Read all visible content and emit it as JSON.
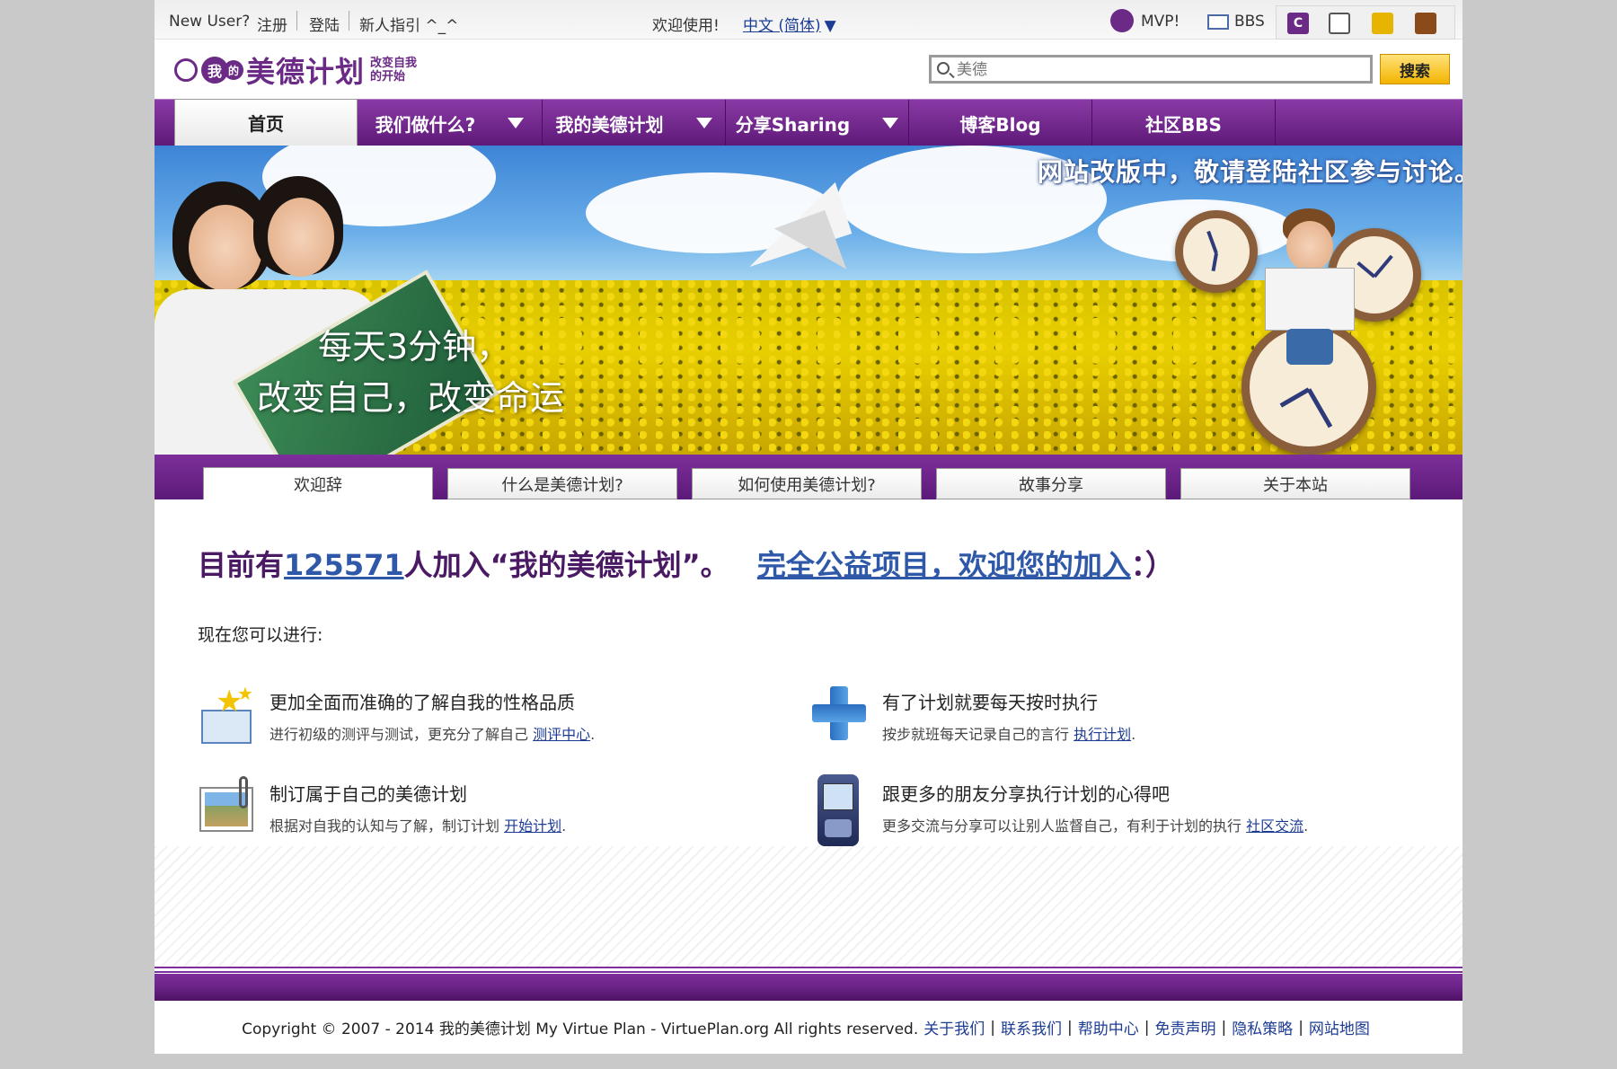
{
  "topbar": {
    "new_user": "New User?",
    "register": "注册",
    "login": "登陆",
    "guide": "新人指引 ^_^",
    "welcome": "欢迎使用!",
    "language": "中文 (简体)",
    "mvp": "MVP!",
    "bbs": "BBS",
    "icons": [
      "c-icon",
      "window-icon",
      "coins-icon",
      "shield-icon"
    ]
  },
  "header": {
    "logo_prefix": "我",
    "logo_bubble": "的",
    "logo_name": "美德计划",
    "logo_slogan": "改变自我的开始",
    "search_placeholder": "美德",
    "search_button": "搜索"
  },
  "nav": {
    "items": [
      {
        "label": "首页",
        "dropdown": false,
        "active": true
      },
      {
        "label": "我们做什么?",
        "dropdown": true,
        "active": false
      },
      {
        "label": "我的美德计划",
        "dropdown": true,
        "active": false
      },
      {
        "label": "分享Sharing",
        "dropdown": true,
        "active": false
      },
      {
        "label": "博客Blog",
        "dropdown": false,
        "active": false
      },
      {
        "label": "社区BBS",
        "dropdown": false,
        "active": false
      }
    ]
  },
  "banner": {
    "notice": "网站改版中，敬请登陆社区参与讨论。",
    "line1": "每天3分钟，",
    "line2": "改变自己，改变命运"
  },
  "subtabs": [
    "欢迎辞",
    "什么是美德计划?",
    "如何使用美德计划?",
    "故事分享",
    "关于本站"
  ],
  "main": {
    "headline_prefix": "目前有",
    "member_count": "125571",
    "headline_mid": "人加入“我的美德计划”。",
    "headline_link": "完全公益项目，欢迎您的加入",
    "headline_suffix": "：）",
    "now_text": "现在您可以进行:",
    "features": [
      {
        "title": "更加全面而准确的了解自我的性格品质",
        "desc": "进行初级的测评与测试，更充分了解自己",
        "link": "测评中心",
        "icon": "star-envelope-icon"
      },
      {
        "title": "有了计划就要每天按时执行",
        "desc": "按步就班每天记录自己的言行",
        "link": "执行计划",
        "icon": "plus-icon"
      },
      {
        "title": "制订属于自己的美德计划",
        "desc": "根据对自我的认知与了解，制订计划",
        "link": "开始计划",
        "icon": "photo-clip-icon"
      },
      {
        "title": "跟更多的朋友分享执行计划的心得吧",
        "desc": "更多交流与分享可以让别人监督自己，有利于计划的执行",
        "link": "社区交流",
        "icon": "mobile-phone-icon"
      }
    ]
  },
  "footer": {
    "copyright": "Copyright © 2007 - 2014 我的美德计划 My Virtue Plan - VirtuePlan.org All rights reserved.",
    "links": [
      "关于我们",
      "联系我们",
      "帮助中心",
      "免责声明",
      "隐私策略",
      "网站地图"
    ]
  },
  "colors": {
    "purple": "#6b2a85",
    "link_blue": "#2f59a8",
    "search_button": "#f3b400"
  }
}
